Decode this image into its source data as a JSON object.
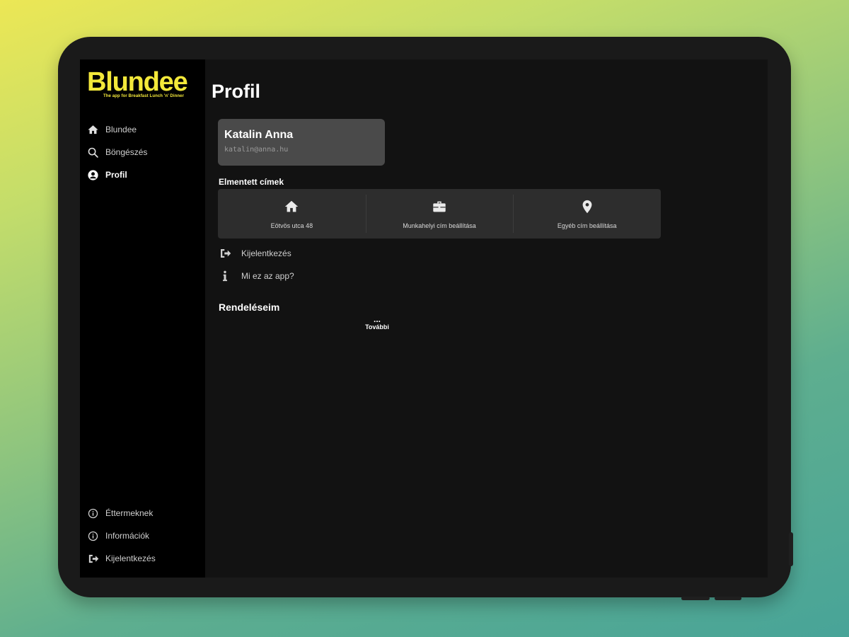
{
  "app": {
    "logo_text": "Blundee",
    "tagline": "The app for Breakfast Lunch 'n' Dinner",
    "brand_color": "#f3e83a"
  },
  "sidebar": {
    "nav": [
      {
        "label": "Blundee",
        "icon": "home-icon",
        "active": false
      },
      {
        "label": "Böngészés",
        "icon": "search-icon",
        "active": false
      },
      {
        "label": "Profil",
        "icon": "account-circle-icon",
        "active": true
      }
    ],
    "footer": [
      {
        "label": "Éttermeknek",
        "icon": "info-circle-icon"
      },
      {
        "label": "Információk",
        "icon": "info-circle-icon"
      },
      {
        "label": "Kijelentkezés",
        "icon": "logout-icon"
      }
    ]
  },
  "main": {
    "title": "Profil",
    "profile": {
      "name": "Katalin Anna",
      "email": "katalin@anna.hu"
    },
    "saved_addresses": {
      "heading": "Elmentett címek",
      "items": [
        {
          "label": "Eötvös utca 48",
          "icon": "home-icon"
        },
        {
          "label": "Munkahelyi cím beállítása",
          "icon": "briefcase-icon"
        },
        {
          "label": "Egyéb cím beállítása",
          "icon": "map-pin-icon"
        }
      ]
    },
    "actions": [
      {
        "label": "Kijelentkezés",
        "icon": "logout-icon"
      },
      {
        "label": "Mi ez az app?",
        "icon": "info-icon"
      }
    ],
    "orders": {
      "heading": "Rendeléseim",
      "more_label": "További",
      "more_dots": "..."
    }
  }
}
